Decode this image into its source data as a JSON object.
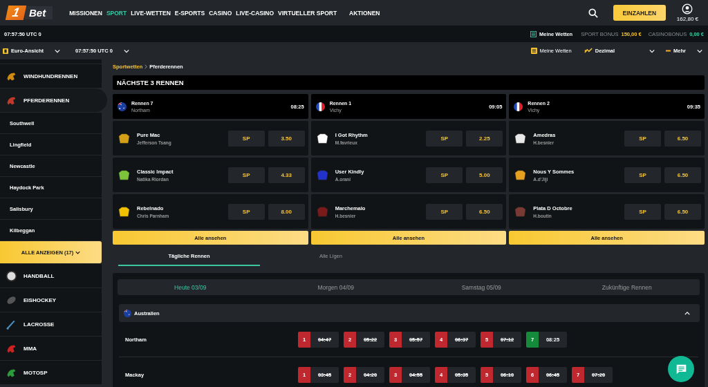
{
  "topnav": {
    "logo_digit": "1",
    "logo_text": "Bet",
    "links": [
      {
        "label": "MISSIONEN",
        "selected": false
      },
      {
        "label": "SPORT",
        "selected": true
      },
      {
        "label": "LIVE-WETTEN",
        "selected": false
      },
      {
        "label": "E-SPORTS",
        "selected": false
      },
      {
        "label": "CASINO",
        "selected": false
      },
      {
        "label": "LIVE-CASINO",
        "selected": false
      },
      {
        "label": "VIRTUELLER SPORT",
        "selected": false
      },
      {
        "label": "AKTIONEN",
        "selected": false
      }
    ],
    "deposit_button": "EINZAHLEN",
    "balance": "162,80 €"
  },
  "infobar": {
    "clock": "07:57:50 UTC 0",
    "my_bets": "Meine Wetten",
    "sport_bonus_label": "SPORT BONUS",
    "sport_bonus": "150,00 €",
    "casino_bonus_label": "CASINOBONUS",
    "casino_bonus": "0,00 €"
  },
  "toolbar": {
    "view": "Euro-Ansicht",
    "clock": "07:57:50 UTC 0",
    "my_bets": "Meine Wetten",
    "odds_format": "Dezimal",
    "more": "Mehr"
  },
  "sidebar": {
    "items": [
      {
        "kind": "sport",
        "label": "WINDHUNDRENNEN",
        "selected": false
      },
      {
        "kind": "sport",
        "label": "PFERDERENNEN",
        "selected": true
      },
      {
        "kind": "venue",
        "label": "Southwell",
        "selected": false
      },
      {
        "kind": "venue",
        "label": "Lingfield",
        "selected": false
      },
      {
        "kind": "venue",
        "label": "Newcastle",
        "selected": false
      },
      {
        "kind": "venue",
        "label": "Haydock Park",
        "selected": false
      },
      {
        "kind": "venue",
        "label": "Salisbury",
        "selected": false
      },
      {
        "kind": "venue",
        "label": "Kilbeggan",
        "selected": false
      },
      {
        "kind": "more",
        "label": "ALLE ANZEIGEN (17)",
        "selected": false
      },
      {
        "kind": "sport",
        "label": "HANDBALL",
        "selected": false
      },
      {
        "kind": "sport",
        "label": "EISHOCKEY",
        "selected": false
      },
      {
        "kind": "sport",
        "label": "LACROSSE",
        "selected": false
      },
      {
        "kind": "sport",
        "label": "MMA",
        "selected": false
      },
      {
        "kind": "sport",
        "label": "MOTOSP",
        "selected": false
      }
    ]
  },
  "breadcrumb": [
    "Sportwetten",
    "Pferderennen"
  ],
  "next_races": {
    "title": "NÄCHSTE 3 RENNEN",
    "races": [
      {
        "title": "Rennen 7",
        "venue": "Northam",
        "time": "08:25",
        "flag": {
          "kind": "au"
        },
        "button": "Alle ansehen",
        "runners": [
          {
            "name": "Pure Mac",
            "jockey": "Jefferson Tsang",
            "color": "#d4a017",
            "sp": "SP",
            "odds": "3.50"
          },
          {
            "name": "Classic Impact",
            "jockey": "Natika Riordan",
            "color": "#7cc53a",
            "sp": "SP",
            "odds": "4.33"
          },
          {
            "name": "Rebelnado",
            "jockey": "Chris Parnham",
            "color": "#f2c200",
            "sp": "SP",
            "odds": "8.00"
          }
        ]
      },
      {
        "title": "Rennen 1",
        "venue": "Vichy",
        "time": "09:05",
        "flag": {
          "kind": "fr"
        },
        "button": "Alle ansehen",
        "runners": [
          {
            "name": "I Got Rhythm",
            "jockey": "M.favrieux",
            "color": "#ffffff",
            "sp": "SP",
            "odds": "2.25"
          },
          {
            "name": "User Kindly",
            "jockey": "A.orani",
            "color": "#2233cc",
            "sp": "SP",
            "odds": "5.00"
          },
          {
            "name": "Marchemalo",
            "jockey": "H.besnier",
            "color": "#7a1a1a",
            "sp": "SP",
            "odds": "6.50"
          }
        ]
      },
      {
        "title": "Rennen 2",
        "venue": "Vichy",
        "time": "09:35",
        "flag": {
          "kind": "fr"
        },
        "button": "Alle ansehen",
        "runners": [
          {
            "name": "Amedras",
            "jockey": "H.besnier",
            "color": "#e8e8e8",
            "sp": "SP",
            "odds": "6.50"
          },
          {
            "name": "Nous Y Sommes",
            "jockey": "A.d'Jiji",
            "color": "#e6a020",
            "sp": "SP",
            "odds": "6.50"
          },
          {
            "name": "Plata D Octobre",
            "jockey": "H.boutin",
            "color": "#7a3a34",
            "sp": "SP",
            "odds": "6.50"
          }
        ]
      }
    ]
  },
  "tabs": [
    {
      "label": "Tägliche Rennen",
      "selected": true
    },
    {
      "label": "Alle Ligen",
      "selected": false
    }
  ],
  "day_tabs": [
    {
      "label": "Heute 03/09",
      "selected": true
    },
    {
      "label": "Morgen 04/09",
      "selected": false
    },
    {
      "label": "Samstag 05/09",
      "selected": false
    },
    {
      "label": "Zukünftige Rennen",
      "selected": false
    }
  ],
  "regions": [
    {
      "country": "Australien",
      "flag": {
        "kind": "au"
      },
      "expanded": true,
      "tracks": [
        {
          "name": "Northam",
          "races": [
            {
              "number": "1",
              "time": "04:47",
              "finished": true,
              "color": "#c0282f"
            },
            {
              "number": "2",
              "time": "05:22",
              "finished": true,
              "color": "#c0282f"
            },
            {
              "number": "3",
              "time": "05:57",
              "finished": true,
              "color": "#c0282f"
            },
            {
              "number": "4",
              "time": "06:37",
              "finished": true,
              "color": "#c0282f"
            },
            {
              "number": "5",
              "time": "07:12",
              "finished": true,
              "color": "#c0282f"
            },
            {
              "number": "7",
              "time": "08:25",
              "finished": false,
              "color": "#148a3a"
            }
          ]
        },
        {
          "name": "Mackay",
          "races": [
            {
              "number": "1",
              "time": "03:45",
              "finished": true,
              "color": "#c0282f"
            },
            {
              "number": "2",
              "time": "04:20",
              "finished": true,
              "color": "#c0282f"
            },
            {
              "number": "3",
              "time": "04:55",
              "finished": true,
              "color": "#c0282f"
            },
            {
              "number": "4",
              "time": "05:35",
              "finished": true,
              "color": "#c0282f"
            },
            {
              "number": "5",
              "time": "06:10",
              "finished": true,
              "color": "#c0282f"
            },
            {
              "number": "6",
              "time": "06:45",
              "finished": true,
              "color": "#c0282f"
            },
            {
              "number": "7",
              "time": "07:20",
              "finished": true,
              "color": "#c0282f"
            }
          ]
        }
      ]
    }
  ]
}
